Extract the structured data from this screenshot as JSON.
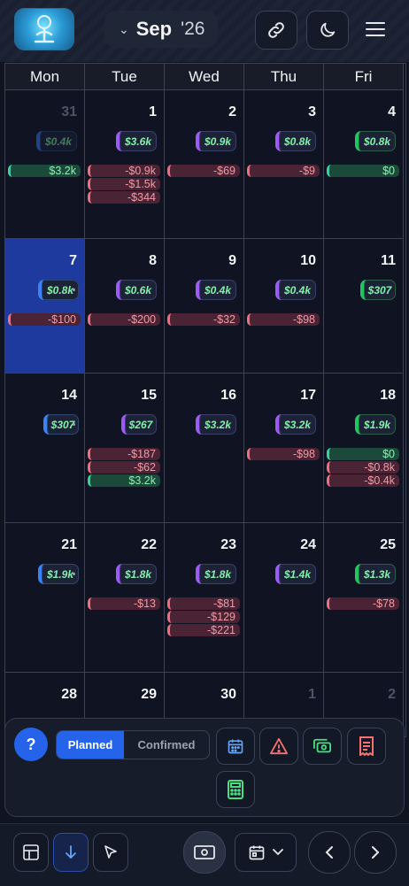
{
  "header": {
    "month": "Sep",
    "year": "'26"
  },
  "weekdays": [
    "Mon",
    "Tue",
    "Wed",
    "Thu",
    "Fri"
  ],
  "weeks": [
    {
      "days": [
        {
          "day": "31",
          "other": true,
          "total": "$0.4k",
          "total_color": "blue",
          "dim": true,
          "entries": [
            {
              "amount": "$3.2k",
              "kind": "pos"
            }
          ]
        },
        {
          "day": "1",
          "total": "$3.6k",
          "total_color": "purple",
          "entries": [
            {
              "amount": "-$0.9k",
              "kind": "neg"
            },
            {
              "amount": "-$1.5k",
              "kind": "neg"
            },
            {
              "amount": "-$344",
              "kind": "neg"
            }
          ]
        },
        {
          "day": "2",
          "total": "$0.9k",
          "total_color": "purple",
          "entries": [
            {
              "amount": "-$69",
              "kind": "neg"
            }
          ]
        },
        {
          "day": "3",
          "total": "$0.8k",
          "total_color": "purple",
          "entries": [
            {
              "amount": "-$9",
              "kind": "neg"
            }
          ]
        },
        {
          "day": "4",
          "total": "$0.8k",
          "total_color": "green",
          "entries": [
            {
              "amount": "$0",
              "kind": "pos"
            }
          ]
        }
      ]
    },
    {
      "days": [
        {
          "day": "7",
          "selected": true,
          "total": "$0.8k",
          "total_color": "blue",
          "dot": true,
          "entries": [
            {
              "amount": "-$100",
              "kind": "neg"
            }
          ]
        },
        {
          "day": "8",
          "total": "$0.6k",
          "total_color": "purple",
          "entries": [
            {
              "amount": "-$200",
              "kind": "neg"
            }
          ]
        },
        {
          "day": "9",
          "total": "$0.4k",
          "total_color": "purple",
          "entries": [
            {
              "amount": "-$32",
              "kind": "neg"
            }
          ]
        },
        {
          "day": "10",
          "total": "$0.4k",
          "total_color": "purple",
          "entries": [
            {
              "amount": "-$98",
              "kind": "neg"
            }
          ]
        },
        {
          "day": "11",
          "total": "$307",
          "total_color": "green",
          "entries": []
        }
      ]
    },
    {
      "days": [
        {
          "day": "14",
          "total": "$307",
          "total_color": "blue",
          "dot": true,
          "entries": []
        },
        {
          "day": "15",
          "total": "$267",
          "total_color": "purple",
          "entries": [
            {
              "amount": "-$187",
              "kind": "neg"
            },
            {
              "amount": "-$62",
              "kind": "neg"
            },
            {
              "amount": "$3.2k",
              "kind": "pos"
            }
          ]
        },
        {
          "day": "16",
          "total": "$3.2k",
          "total_color": "purple",
          "entries": []
        },
        {
          "day": "17",
          "total": "$3.2k",
          "total_color": "purple",
          "entries": [
            {
              "amount": "-$98",
              "kind": "neg"
            }
          ]
        },
        {
          "day": "18",
          "total": "$1.9k",
          "total_color": "green",
          "entries": [
            {
              "amount": "$0",
              "kind": "pos"
            },
            {
              "amount": "-$0.8k",
              "kind": "neg"
            },
            {
              "amount": "-$0.4k",
              "kind": "neg"
            }
          ]
        }
      ]
    },
    {
      "days": [
        {
          "day": "21",
          "total": "$1.9k",
          "total_color": "blue",
          "dot": true,
          "entries": []
        },
        {
          "day": "22",
          "total": "$1.8k",
          "total_color": "purple",
          "entries": [
            {
              "amount": "-$13",
              "kind": "neg"
            }
          ]
        },
        {
          "day": "23",
          "total": "$1.8k",
          "total_color": "purple",
          "entries": [
            {
              "amount": "-$81",
              "kind": "neg"
            },
            {
              "amount": "-$129",
              "kind": "neg"
            },
            {
              "amount": "-$221",
              "kind": "neg"
            }
          ]
        },
        {
          "day": "24",
          "total": "$1.4k",
          "total_color": "purple",
          "entries": []
        },
        {
          "day": "25",
          "total": "$1.3k",
          "total_color": "green",
          "entries": [
            {
              "amount": "-$78",
              "kind": "neg"
            }
          ]
        }
      ]
    },
    {
      "days": [
        {
          "day": "28",
          "entries": []
        },
        {
          "day": "29",
          "entries": []
        },
        {
          "day": "30",
          "entries": []
        },
        {
          "day": "1",
          "other": true,
          "entries": []
        },
        {
          "day": "2",
          "other": true,
          "entries": []
        }
      ]
    }
  ],
  "panel": {
    "help_label": "?",
    "planned_label": "Planned",
    "confirmed_label": "Confirmed",
    "icons": [
      "calendar-icon",
      "warning-icon",
      "cash-icon",
      "receipt-icon",
      "calculator-icon"
    ]
  },
  "bottom": {
    "icons": [
      "grid-icon",
      "arrow-down-icon",
      "cursor-icon",
      "money-icon",
      "calendar-icon",
      "chevron-down-icon",
      "chevron-left-icon",
      "chevron-right-icon"
    ]
  },
  "colors": {
    "accent": "#2563eb",
    "positive": "#34d399",
    "negative": "#f26d7d",
    "selected_day": "#1f3a9e"
  }
}
